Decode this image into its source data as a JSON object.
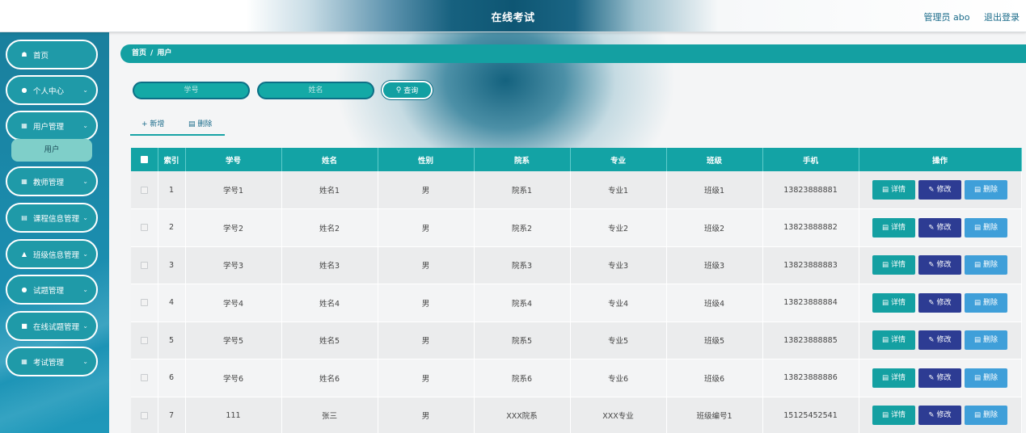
{
  "header": {
    "title": "在线考试",
    "user_label": "管理员 abo",
    "logout_label": "退出登录"
  },
  "sidebar": {
    "items": [
      {
        "label": "首页",
        "icon": "home-icon",
        "has_chevron": false
      },
      {
        "label": "个人中心",
        "icon": "user-icon",
        "has_chevron": true
      },
      {
        "label": "用户管理",
        "icon": "grid-icon",
        "has_chevron": true
      },
      {
        "label": "教师管理",
        "icon": "grid-icon",
        "has_chevron": true
      },
      {
        "label": "课程信息管理",
        "icon": "clipboard-icon",
        "has_chevron": true
      },
      {
        "label": "班级信息管理",
        "icon": "thumbs-up-icon",
        "has_chevron": true
      },
      {
        "label": "试题管理",
        "icon": "bulb-icon",
        "has_chevron": true
      },
      {
        "label": "在线试题管理",
        "icon": "mail-icon",
        "has_chevron": true
      },
      {
        "label": "考试管理",
        "icon": "grid-icon",
        "has_chevron": true
      }
    ],
    "active_submenu": "用户"
  },
  "breadcrumb": {
    "home": "首页",
    "separator": "/",
    "current": "用户"
  },
  "search": {
    "student_id_placeholder": "学号",
    "name_placeholder": "姓名",
    "button_label": "查询"
  },
  "toolbar": {
    "add_label": "新增",
    "delete_label": "删除"
  },
  "table": {
    "columns": [
      "索引",
      "学号",
      "姓名",
      "性别",
      "院系",
      "专业",
      "班级",
      "手机",
      "操作"
    ],
    "action_labels": {
      "detail": "详情",
      "edit": "修改",
      "delete": "删除"
    },
    "rows": [
      {
        "index": "1",
        "student_id": "学号1",
        "name": "姓名1",
        "gender": "男",
        "department": "院系1",
        "major": "专业1",
        "class": "班级1",
        "phone": "13823888881"
      },
      {
        "index": "2",
        "student_id": "学号2",
        "name": "姓名2",
        "gender": "男",
        "department": "院系2",
        "major": "专业2",
        "class": "班级2",
        "phone": "13823888882"
      },
      {
        "index": "3",
        "student_id": "学号3",
        "name": "姓名3",
        "gender": "男",
        "department": "院系3",
        "major": "专业3",
        "class": "班级3",
        "phone": "13823888883"
      },
      {
        "index": "4",
        "student_id": "学号4",
        "name": "姓名4",
        "gender": "男",
        "department": "院系4",
        "major": "专业4",
        "class": "班级4",
        "phone": "13823888884"
      },
      {
        "index": "5",
        "student_id": "学号5",
        "name": "姓名5",
        "gender": "男",
        "department": "院系5",
        "major": "专业5",
        "class": "班级5",
        "phone": "13823888885"
      },
      {
        "index": "6",
        "student_id": "学号6",
        "name": "姓名6",
        "gender": "男",
        "department": "院系6",
        "major": "专业6",
        "class": "班级6",
        "phone": "13823888886"
      },
      {
        "index": "7",
        "student_id": "111",
        "name": "张三",
        "gender": "男",
        "department": "XXX院系",
        "major": "XXX专业",
        "class": "班级编号1",
        "phone": "15125452541"
      }
    ]
  },
  "colors": {
    "accent_teal": "#14a0a2",
    "edit_navy": "#2d3c93",
    "delete_blue": "#3f9fd9",
    "header_blue": "#0e5673"
  }
}
